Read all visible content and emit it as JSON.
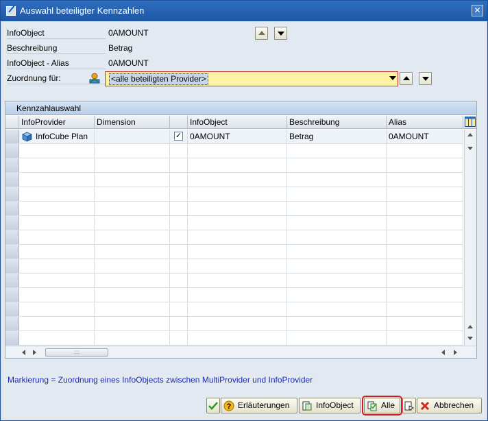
{
  "window": {
    "title": "Auswahl beteiligter Kennzahlen",
    "close_glyph": "✕"
  },
  "form": {
    "infoobject_label": "InfoObject",
    "infoobject_value": "0AMOUNT",
    "beschreibung_label": "Beschreibung",
    "beschreibung_value": "Betrag",
    "alias_label": "InfoObject - Alias",
    "alias_value": "0AMOUNT",
    "zuordnung_label": "Zuordnung für:",
    "zuordnung_value": "<alle beteiligten Provider>"
  },
  "panel": {
    "title": "Kennzahlauswahl"
  },
  "table": {
    "columns": [
      "InfoProvider",
      "Dimension",
      "",
      "InfoObject",
      "Beschreibung",
      "Alias"
    ],
    "rows": [
      {
        "infoprovider": "InfoCube Plan",
        "dimension": "",
        "checked": true,
        "check_glyph": "✓",
        "infoobject": "0AMOUNT",
        "beschreibung": "Betrag",
        "alias": "0AMOUNT"
      }
    ],
    "empty_rows": 14,
    "hscroll_grip": ":::"
  },
  "info_text": "Markierung = Zuordnung eines InfoObjects zwischen MultiProvider und InfoProvider",
  "footer": {
    "erlaeuterungen_label": "Erläuterungen",
    "infoobject_label": "InfoObject",
    "alle_label": "Alle",
    "abbrechen_label": "Abbrechen"
  },
  "colors": {
    "titlebar": "#1d56a5",
    "highlight": "#d31d1d",
    "info_text": "#1b2bb8",
    "combo_background": "#fdf2a6"
  }
}
